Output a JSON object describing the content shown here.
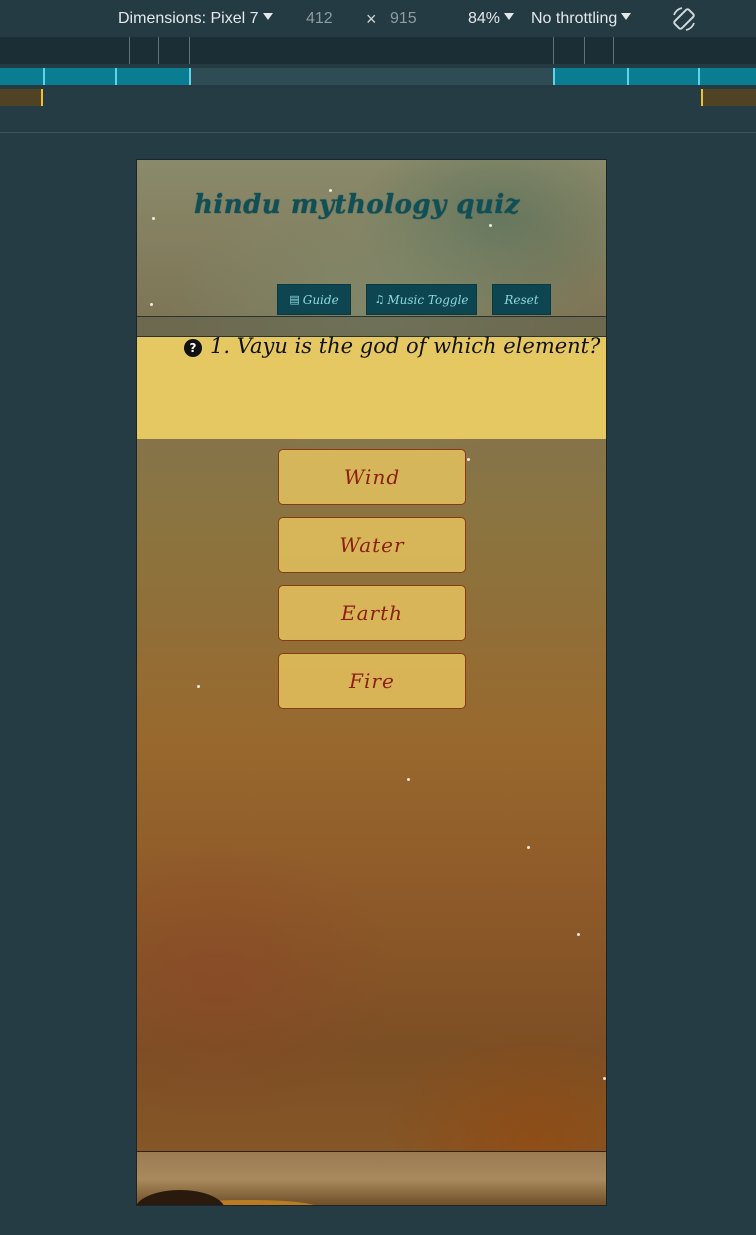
{
  "devtools": {
    "dimensions_label": "Dimensions: Pixel 7",
    "width": "412",
    "times": "×",
    "height": "915",
    "zoom": "84%",
    "throttling": "No throttling"
  },
  "page": {
    "title": "hindu mythology quiz",
    "nav": {
      "guide_icon": "table-icon",
      "guide": "Guide",
      "music_icon": "music-note-icon",
      "music": "Music Toggle",
      "reset": "Reset"
    },
    "question": {
      "icon": "question-circle-icon",
      "text": "1. Vayu is the god of which element?"
    },
    "answers": [
      "Wind",
      "Water",
      "Earth",
      "Fire"
    ]
  },
  "colors": {
    "title": "#0f4f57",
    "nav_button_bg": "#0d4550",
    "nav_button_text": "#8fd8e0",
    "question_bg": "#e6c862",
    "answer_text": "#8c1f10",
    "answer_border": "#8a3a14"
  }
}
